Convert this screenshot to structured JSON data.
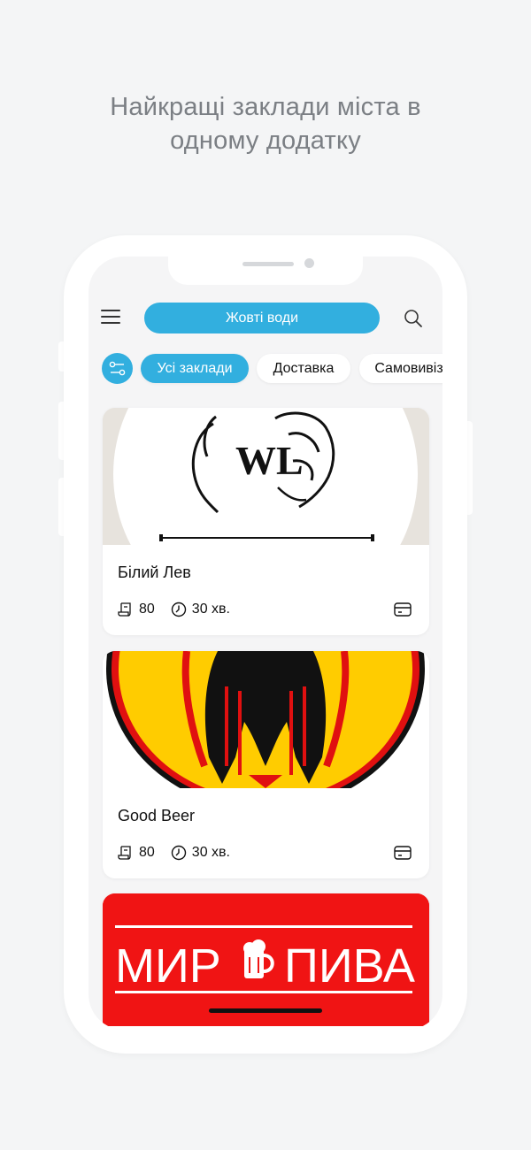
{
  "headline": {
    "line1": "Найкращі заклади міста в",
    "line2": "одному додатку"
  },
  "topbar": {
    "menu_icon": "hamburger-icon",
    "city": "Жовті води",
    "search_icon": "search-icon"
  },
  "filters": {
    "filter_icon": "filter-sliders-icon",
    "chips": [
      {
        "label": "Усі заклади",
        "active": true
      },
      {
        "label": "Доставка",
        "active": false
      },
      {
        "label": "Самовивіз",
        "active": false
      }
    ]
  },
  "venues": [
    {
      "name": "Білий Лев",
      "receipt_value": "80",
      "time_value": "30 хв.",
      "logo_text": "WL",
      "payment_icon": "card-icon"
    },
    {
      "name": "Good Beer",
      "receipt_value": "80",
      "time_value": "30 хв.",
      "payment_icon": "card-icon"
    },
    {
      "logo_text_left": "МИР",
      "logo_text_right": "ПИВА"
    }
  ],
  "colors": {
    "accent": "#32afdf",
    "background": "#f4f5f6",
    "headline": "#7b7f84",
    "mir_piva_red": "#f01414",
    "eagle_yellow": "#ffcc00"
  }
}
